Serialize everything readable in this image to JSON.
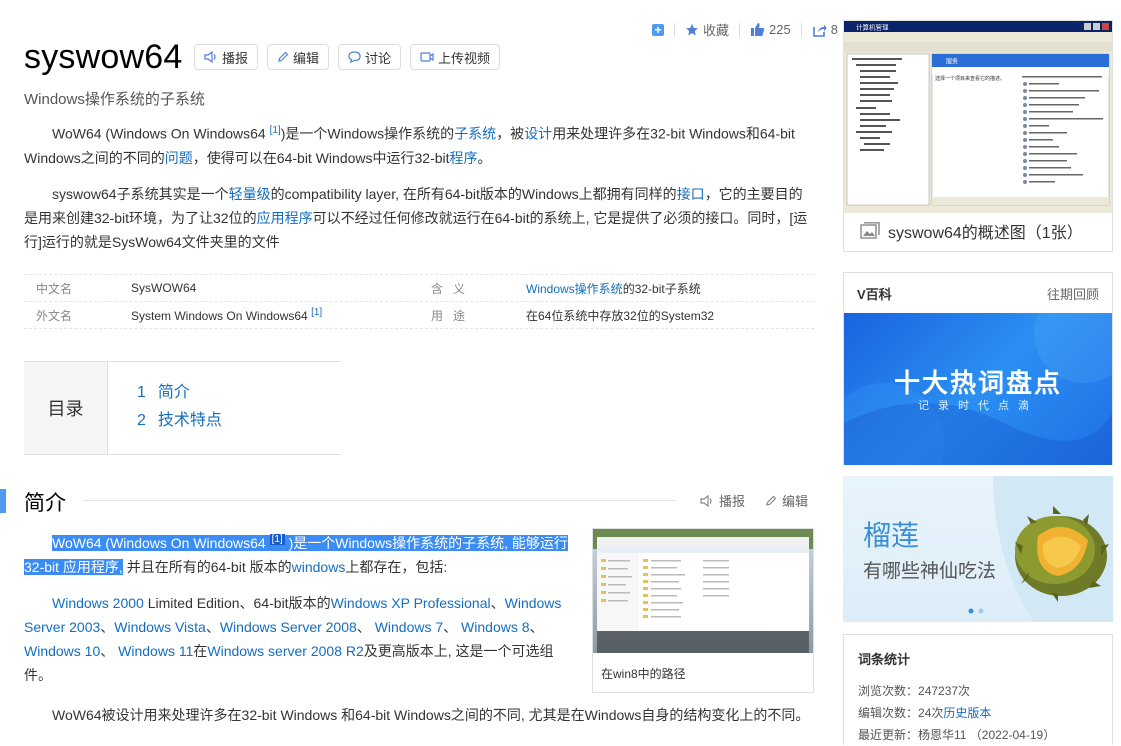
{
  "actions": {
    "favorite_label": "收藏",
    "like_count": "225",
    "share_count": "8"
  },
  "title": "syswow64",
  "buttons": {
    "report": "播报",
    "edit": "编辑",
    "discuss": "讨论",
    "upload_video": "上传视频"
  },
  "subtitle": "Windows操作系统的子系统",
  "summary": {
    "p1_a": "WoW64 (Windows On Windows64 ",
    "p1_ref": "[1]",
    "p1_b": ")是一个Windows操作系统的",
    "p1_link1": "子系统",
    "p1_c": "，被",
    "p1_link2": "设计",
    "p1_d": "用来处理许多在32-bit Windows和64-bit Windows之间的不同的",
    "p1_link3": "问题",
    "p1_e": "，使得可以在64-bit Windows中运行32-bit",
    "p1_link4": "程序",
    "p1_f": "。",
    "p2_a": "syswow64子系统其实是一个",
    "p2_link1": "轻量级",
    "p2_b": "的compatibility layer, 在所有64-bit版本的Windows上都拥有同样的",
    "p2_link2": "接口",
    "p2_c": "，它的主要目的是用来创建32-bit环境，为了让32位的",
    "p2_link3": "应用程序",
    "p2_d": "可以不经过任何修改就运行在64-bit的系统上, 它是提供了必须的接口。同时，[运行]运行的就是SysWow64文件夹里的文件"
  },
  "infobox": {
    "rows": [
      {
        "k1": "中文名",
        "v1": "SysWOW64",
        "k2": "含义",
        "v2_link": "Windows操作系统",
        "v2_rest": "的32-bit子系统",
        "ref": ""
      },
      {
        "k1": "外文名",
        "v1": "System Windows On Windows64 ",
        "k2": "用途",
        "v2_link": "",
        "v2_rest": "在64位系统中存放32位的System32",
        "ref": "[1]"
      }
    ]
  },
  "toc": {
    "heading": "目录",
    "items": [
      {
        "num": "1",
        "label": "简介"
      },
      {
        "num": "2",
        "label": "技术特点"
      }
    ]
  },
  "section": {
    "title": "简介",
    "report": "播报",
    "edit": "编辑"
  },
  "intro": {
    "p1_a": "WoW64 (Windows On Windows64 ",
    "p1_ref": "[1]",
    "p1_b": " )是一个Windows操作系统的子系统, 能够运行32-bit 应用程序,",
    "p1_c": " 并且在所有的64-bit 版本的",
    "p1_link": "windows",
    "p1_d": "上都存在，包括:",
    "p2": [
      {
        "t": "Windows 2000",
        "link": true
      },
      {
        "t": " Limited Edition、64-bit版本的",
        "link": false
      },
      {
        "t": "Windows XP Professional",
        "link": true
      },
      {
        "t": "、",
        "link": false
      },
      {
        "t": "Windows Server 2003",
        "link": true
      },
      {
        "t": "、",
        "link": false
      },
      {
        "t": "Windows Vista",
        "link": true
      },
      {
        "t": "、",
        "link": false
      },
      {
        "t": "Windows Server 2008",
        "link": true
      },
      {
        "t": "、 ",
        "link": false
      },
      {
        "t": "Windows 7",
        "link": true
      },
      {
        "t": "、 ",
        "link": false
      },
      {
        "t": "Windows 8",
        "link": true
      },
      {
        "t": "、",
        "link": false
      },
      {
        "t": "Windows 10",
        "link": true
      },
      {
        "t": "、 ",
        "link": false
      },
      {
        "t": "Windows 11",
        "link": true
      },
      {
        "t": "在",
        "link": false
      },
      {
        "t": "Windows server 2008 R2",
        "link": true
      },
      {
        "t": "及更高版本上, 这是一个可选组件。",
        "link": false
      }
    ],
    "p3": "WoW64被设计用来处理许多在32-bit Windows 和64-bit Windows之间的不同, 尤其是在Windows自身的结构变化上的不同。",
    "image_caption": "在win8中的路径"
  },
  "album": {
    "caption": "syswow64的概述图（1张）",
    "window_title": "计算机管理",
    "pane_title": "服务",
    "pane_hint": "选择一个项目来查看它的描述。"
  },
  "vbaike": {
    "logo": "V百科",
    "more": "往期回顾",
    "banner_title": "十大热词盘点",
    "banner_sub": "记录时代点滴"
  },
  "promo": {
    "title": "榴莲",
    "subtitle": "有哪些神仙吃法"
  },
  "stats": {
    "heading": "词条统计",
    "views_label": "浏览次数：",
    "views_value": "247237次",
    "edits_label": "编辑次数：",
    "edits_value": "24次",
    "history_link": "历史版本",
    "updated_label": "最近更新：",
    "updated_value": "杨恩华11  （2022-04-19）"
  },
  "colors": {
    "link": "#136ec2",
    "accent": "#4f9cee",
    "selection": "#3b8df5"
  }
}
